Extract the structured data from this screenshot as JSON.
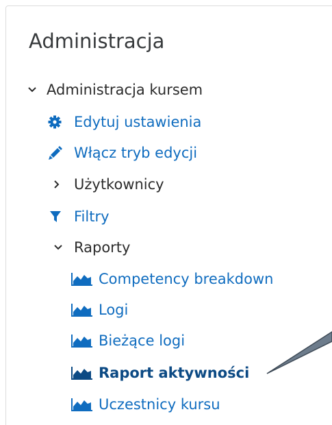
{
  "block": {
    "title": "Administracja"
  },
  "nav": {
    "course_admin": "Administracja kursem",
    "edit_settings": "Edytuj ustawienia",
    "edit_mode": "Włącz tryb edycji",
    "users": "Użytkownicy",
    "filters": "Filtry",
    "reports": "Raporty",
    "report_items": [
      "Competency breakdown",
      "Logi",
      "Bieżące logi",
      "Raport aktywności",
      "Uczestnicy kursu"
    ]
  },
  "colors": {
    "link": "#0f6cbf",
    "text": "#2b2b2b",
    "title": "#373a3c",
    "active": "#0c4a84"
  }
}
